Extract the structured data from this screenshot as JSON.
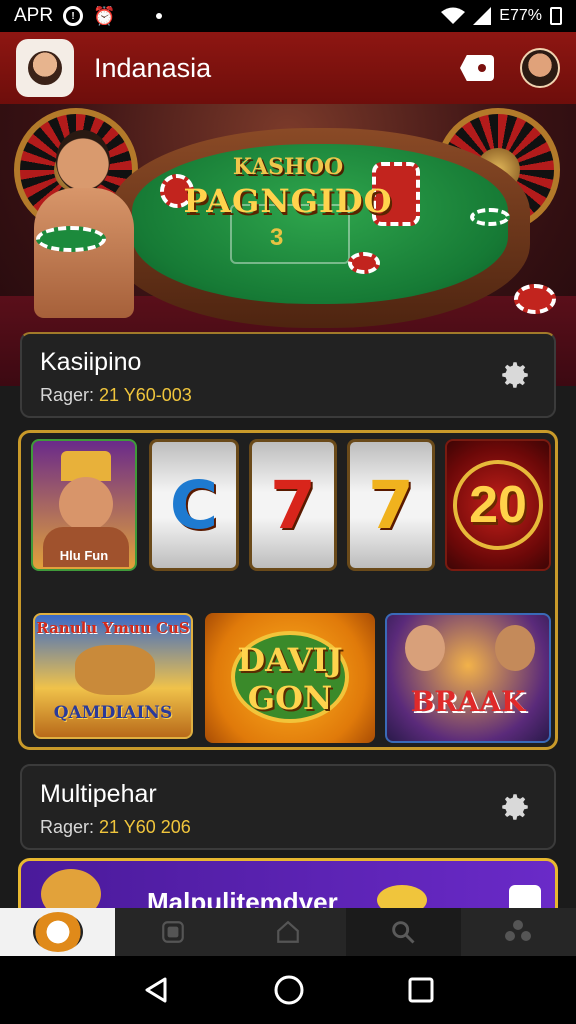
{
  "status_bar": {
    "left_text": "APR",
    "battery_text": "E77%"
  },
  "app_bar": {
    "title": "Indanasia"
  },
  "hero": {
    "line1": "KASHOO",
    "line2": "PAGNGIDO",
    "number": "3"
  },
  "cards": [
    {
      "title": "Kasiipino",
      "sub_label": "Rager:",
      "sub_value": "21 Y60-003"
    },
    {
      "title": "Multipehar",
      "sub_label": "Rager:",
      "sub_value": "21 Y60 206"
    }
  ],
  "games": {
    "pharaoh_caption": "Hlu Fun",
    "reel1": "C",
    "reel2": "7",
    "reel3": "7",
    "badge_20": "20",
    "tile5_top": "Ranulu Ymuu CuS",
    "tile5_bottom": "QAMDIAINS",
    "tile6_line1": "DAVIJ",
    "tile6_line2": "GON",
    "tile7": "BRAAK"
  },
  "promo": {
    "title": "Malpulitemdyer"
  },
  "colors": {
    "appbar": "#8e1612",
    "accent_gold": "#c99a2a",
    "value_yellow": "#f0c53c"
  }
}
